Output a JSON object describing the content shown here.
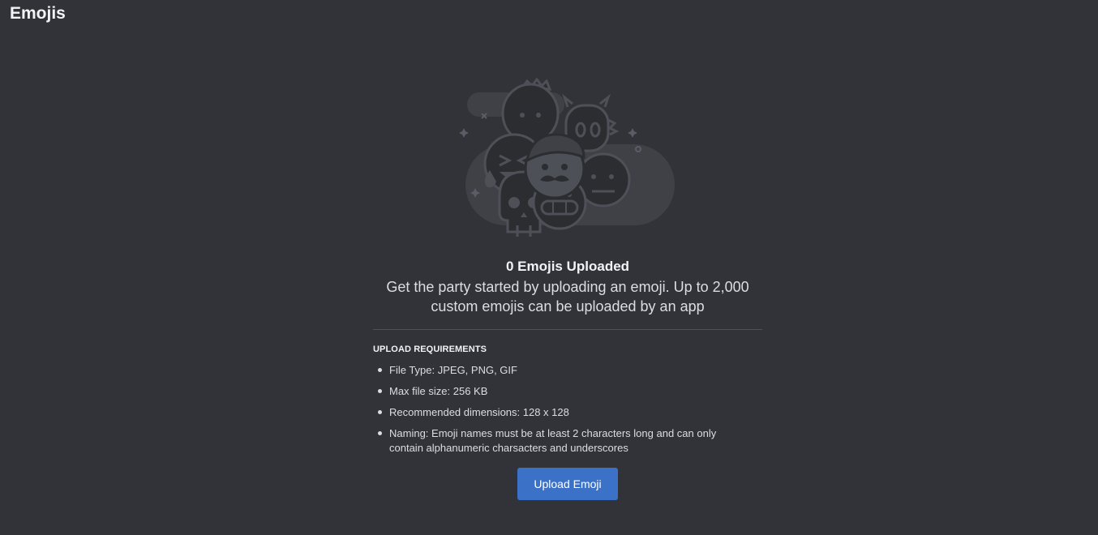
{
  "header": {
    "title": "Emojis"
  },
  "illustration": {
    "icon": "emoji-group-illustration"
  },
  "empty_state": {
    "heading": "0 Emojis Uploaded",
    "description": "Get the party started by uploading an emoji. Up to 2,000 custom emojis can be uploaded by an app"
  },
  "requirements": {
    "heading": "UPLOAD REQUIREMENTS",
    "items": [
      "File Type: JPEG, PNG, GIF",
      "Max file size: 256 KB",
      "Recommended dimensions: 128 x 128",
      "Naming: Emoji names must be at least 2 characters long and can only contain alphanumeric charsacters and underscores"
    ]
  },
  "actions": {
    "upload_label": "Upload Emoji"
  },
  "colors": {
    "background": "#313338",
    "button": "#3b72c8",
    "divider": "#4e5058"
  }
}
